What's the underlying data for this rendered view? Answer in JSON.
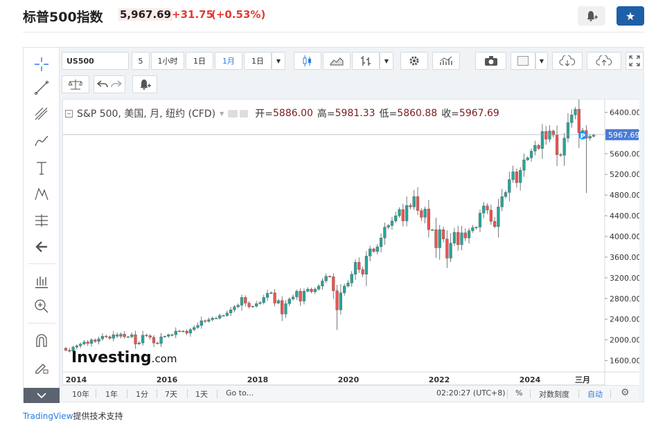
{
  "header": {
    "title": "标普500指数",
    "price": "5,967.69",
    "change": "+31.75",
    "change_pct": "(+0.53%)",
    "alert_icon": "bell-plus-icon",
    "favorite_icon": "star-icon"
  },
  "toolbar": {
    "symbol": "US500",
    "intervals": [
      "5",
      "1小时",
      "1日",
      "1月",
      "1日"
    ],
    "active_interval": "1月"
  },
  "legend": {
    "name": "S&P 500, 美国, 月, 纽约 (CFD)",
    "open_label": "开=",
    "open": "5886.00",
    "high_label": "高=",
    "high": "5981.33",
    "low_label": "低=",
    "low": "5860.88",
    "close_label": "收=",
    "close": "5967.69"
  },
  "bottom_bar": {
    "ranges": [
      "10年",
      "1年",
      "1分",
      "7天",
      "1天"
    ],
    "goto": "Go to...",
    "time": "02:20:27 (UTC+8)",
    "percent": "%",
    "log_scale": "对数刻度",
    "auto": "自动"
  },
  "footer": {
    "brand": "TradingView",
    "suffix": "提供技术支持"
  },
  "chart_data": {
    "type": "candlestick",
    "up_color": "#26a69a",
    "down_color": "#ef5350",
    "last_price_label": "5967.69",
    "marker": "P",
    "watermark": "Investing.com",
    "y_ticks": [
      "6400.00",
      "6000.00",
      "5600.00",
      "5200.00",
      "4800.00",
      "4400.00",
      "4000.00",
      "3600.00",
      "3200.00",
      "2800.00",
      "2400.00",
      "2000.00",
      "1600.00"
    ],
    "ylim": [
      1380,
      6540
    ],
    "x_ticks": [
      "2014",
      "2016",
      "2018",
      "2020",
      "2022",
      "2024",
      "三月"
    ],
    "closes": [
      1800,
      1780,
      1860,
      1885,
      1920,
      1960,
      1930,
      2000,
      1970,
      2020,
      2070,
      2060,
      2030,
      2100,
      2070,
      2110,
      2060,
      2060,
      2100,
      1920,
      1940,
      2090,
      2080,
      2050,
      1940,
      1930,
      2060,
      2070,
      2100,
      2100,
      2170,
      2170,
      2170,
      2130,
      2200,
      2240,
      2280,
      2370,
      2360,
      2390,
      2420,
      2420,
      2470,
      2470,
      2520,
      2580,
      2640,
      2670,
      2820,
      2710,
      2640,
      2650,
      2700,
      2720,
      2820,
      2900,
      2910,
      2710,
      2760,
      2500,
      2700,
      2790,
      2830,
      2940,
      2750,
      2940,
      2980,
      2930,
      2980,
      3040,
      3140,
      3230,
      3220,
      2950,
      2580,
      2910,
      3040,
      3100,
      3270,
      3500,
      3360,
      3270,
      3620,
      3760,
      3710,
      3800,
      3970,
      4180,
      4210,
      4300,
      4400,
      4520,
      4300,
      4600,
      4570,
      4770,
      4500,
      4370,
      4530,
      4130,
      4130,
      3780,
      4130,
      3950,
      3580,
      3870,
      4080,
      3840,
      4070,
      3970,
      4110,
      4170,
      4180,
      4450,
      4590,
      4510,
      4290,
      4190,
      4570,
      4770,
      4850,
      5100,
      5250,
      5040,
      5280,
      5480,
      5520,
      5650,
      5760,
      5700,
      6030,
      5880,
      6040,
      5960,
      5580,
      5570,
      5900,
      6200,
      6350,
      6460,
      6000,
      6050,
      5900,
      5935,
      5967.69
    ],
    "opens_first": 1840
  }
}
